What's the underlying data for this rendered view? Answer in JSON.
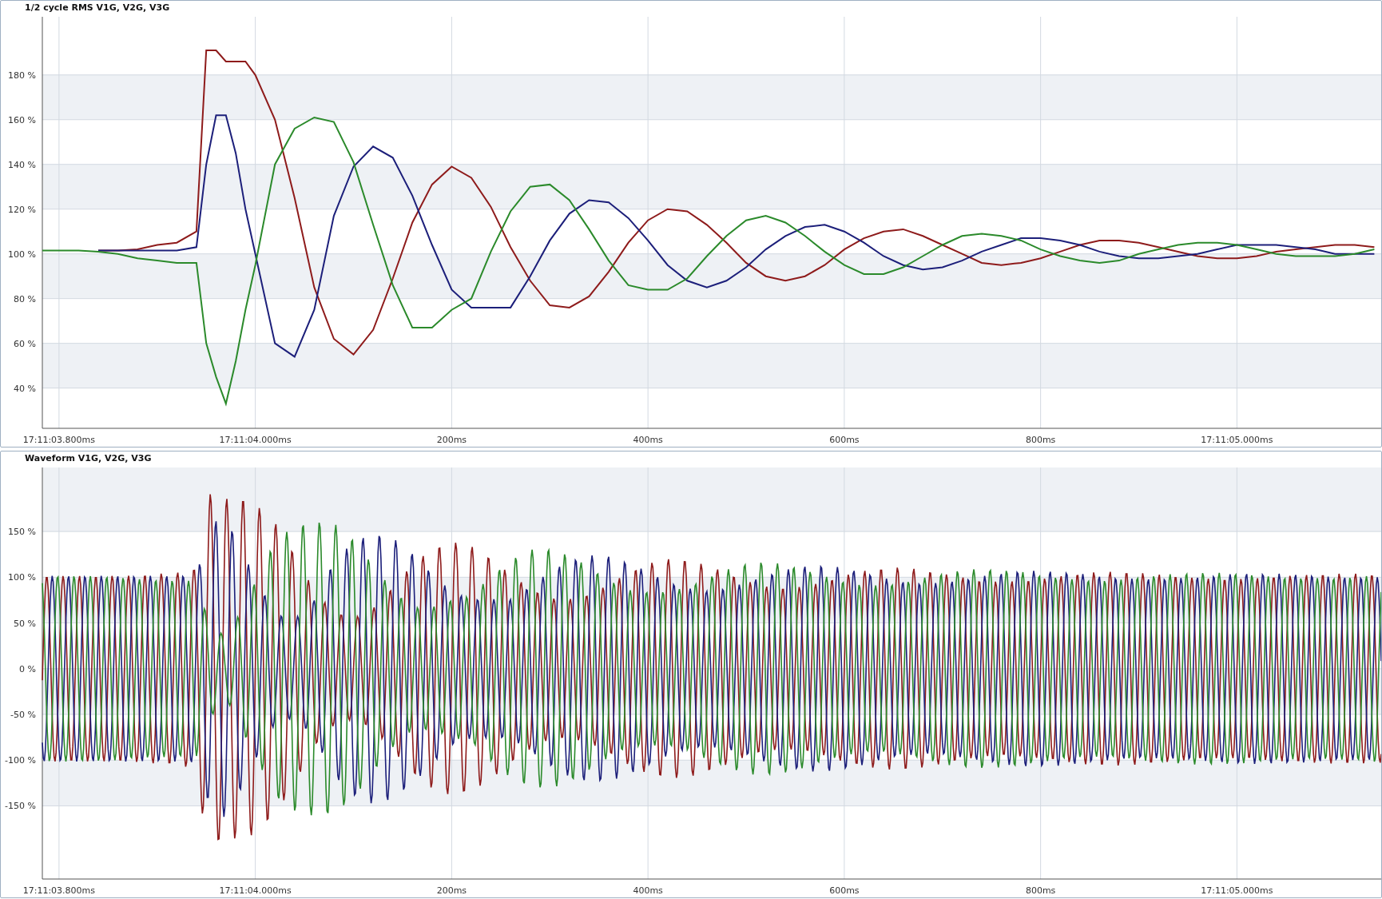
{
  "rms_chart": {
    "title": "1/2 cycle RMS V1G, V2G, V3G",
    "chart_data": {
      "type": "line",
      "grid": true,
      "xlim": [
        -217,
        1147
      ],
      "ylim": [
        22,
        206
      ],
      "x": [
        -217,
        -200,
        -180,
        -160,
        -140,
        -120,
        -100,
        -80,
        -60,
        -50,
        -40,
        -30,
        -20,
        -10,
        0,
        20,
        40,
        60,
        80,
        100,
        120,
        140,
        160,
        180,
        200,
        220,
        240,
        260,
        280,
        300,
        320,
        340,
        360,
        380,
        400,
        420,
        440,
        460,
        480,
        500,
        520,
        540,
        560,
        580,
        600,
        620,
        640,
        660,
        680,
        700,
        720,
        740,
        760,
        780,
        800,
        820,
        840,
        860,
        880,
        900,
        920,
        940,
        960,
        980,
        1000,
        1020,
        1040,
        1060,
        1080,
        1100,
        1120,
        1140
      ],
      "series": [
        {
          "color": "#8e1b1b",
          "values": [
            null,
            null,
            null,
            101.5,
            101.5,
            102,
            104,
            105,
            110,
            191,
            191,
            186,
            186,
            186,
            180,
            160,
            125,
            85,
            62,
            55,
            66,
            89,
            114,
            131,
            139,
            134,
            121,
            103,
            88,
            77,
            76,
            81,
            92,
            105,
            115,
            120,
            119,
            113,
            105,
            96,
            90,
            88,
            90,
            95,
            102,
            107,
            110,
            111,
            108,
            104,
            100,
            96,
            95,
            96,
            98,
            101,
            104,
            106,
            106,
            105,
            103,
            101,
            99,
            98,
            98,
            99,
            101,
            102,
            103,
            104,
            104,
            103
          ]
        },
        {
          "color": "#1c1f7a",
          "values": [
            null,
            null,
            null,
            101.5,
            101.5,
            101.5,
            101.5,
            101.5,
            103,
            140,
            162,
            162,
            145,
            120,
            100,
            60,
            54,
            75,
            117,
            139,
            148,
            143,
            126,
            104,
            84,
            76,
            76,
            76,
            90,
            106,
            118,
            124,
            123,
            116,
            106,
            95,
            88,
            85,
            88,
            94,
            102,
            108,
            112,
            113,
            110,
            105,
            99,
            95,
            93,
            94,
            97,
            101,
            104,
            107,
            107,
            106,
            104,
            101,
            99,
            98,
            98,
            99,
            100,
            102,
            104,
            104,
            104,
            103,
            102,
            100,
            100,
            100
          ]
        },
        {
          "color": "#2b8a2b",
          "values": [
            101.5,
            101.5,
            101.5,
            101,
            100,
            98,
            97,
            96,
            96,
            60,
            45,
            33,
            52,
            75,
            95,
            140,
            156,
            161,
            159,
            141,
            113,
            86,
            67,
            67,
            75,
            80,
            101,
            119,
            130,
            131,
            124,
            111,
            97,
            86,
            84,
            84,
            89,
            99,
            108,
            115,
            117,
            114,
            108,
            101,
            95,
            91,
            91,
            94,
            99,
            104,
            108,
            109,
            108,
            106,
            102,
            99,
            97,
            96,
            97,
            100,
            102,
            104,
            105,
            105,
            104,
            102,
            100,
            99,
            99,
            99,
            100,
            102
          ]
        }
      ],
      "xticks": [
        {
          "value": -200,
          "label": "17:11:03.800ms"
        },
        {
          "value": 0,
          "label": "17:11:04.000ms"
        },
        {
          "value": 200,
          "label": "200ms"
        },
        {
          "value": 400,
          "label": "400ms"
        },
        {
          "value": 600,
          "label": "600ms"
        },
        {
          "value": 800,
          "label": "800ms"
        },
        {
          "value": 1000,
          "label": "17:11:05.000ms"
        }
      ],
      "yticks": [
        {
          "value": 180,
          "label": "180 %"
        },
        {
          "value": 160,
          "label": "160 %"
        },
        {
          "value": 140,
          "label": "140 %"
        },
        {
          "value": 120,
          "label": "120 %"
        },
        {
          "value": 100,
          "label": "100 %"
        },
        {
          "value": 80,
          "label": "80 %"
        },
        {
          "value": 60,
          "label": "60 %"
        },
        {
          "value": 40,
          "label": "40 %"
        }
      ]
    }
  },
  "waveform_chart": {
    "title": "Waveform V1G, V2G, V3G",
    "y_axis_labels": [
      "150 %",
      "100 %",
      "50 %",
      "0 %",
      "-50 %",
      "-100 %",
      "-150 %"
    ],
    "x_axis_labels": [
      "17:11:03.800ms",
      "17:11:04.000ms",
      "200ms",
      "400ms",
      "600ms",
      "800ms",
      "17:11:05.000ms"
    ]
  }
}
